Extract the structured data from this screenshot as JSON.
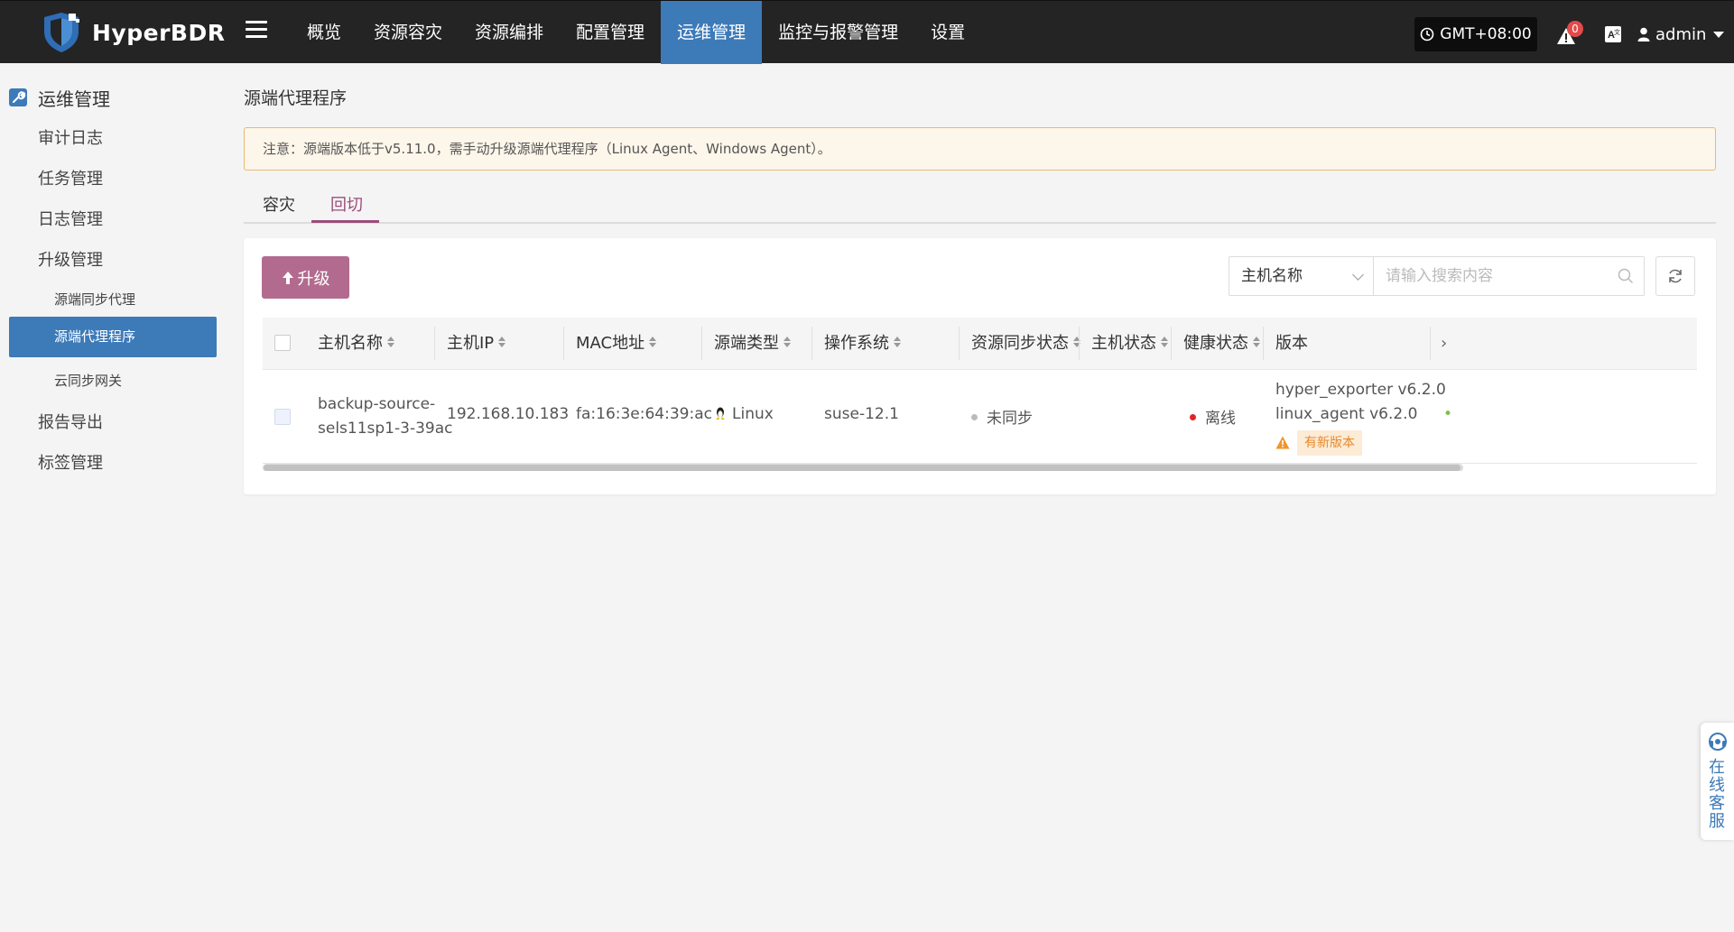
{
  "header": {
    "brand": "HyperBDR",
    "nav": [
      {
        "label": "概览"
      },
      {
        "label": "资源容灾"
      },
      {
        "label": "资源编排"
      },
      {
        "label": "配置管理"
      },
      {
        "label": "运维管理",
        "active": true
      },
      {
        "label": "监控与报警管理"
      },
      {
        "label": "设置"
      }
    ],
    "timezone": "GMT+08:00",
    "alert_count": "0",
    "user": "admin"
  },
  "sidebar": {
    "section_title": "运维管理",
    "items": [
      {
        "label": "审计日志"
      },
      {
        "label": "任务管理"
      },
      {
        "label": "日志管理"
      },
      {
        "label": "升级管理"
      },
      {
        "label": "源端同步代理",
        "sub": true
      },
      {
        "label": "源端代理程序",
        "sub": true,
        "active": true
      },
      {
        "label": "云同步网关",
        "sub": true
      },
      {
        "label": "报告导出"
      },
      {
        "label": "标签管理"
      }
    ]
  },
  "main": {
    "title": "源端代理程序",
    "notice": "注意：源端版本低于v5.11.0，需手动升级源端代理程序（Linux Agent、Windows Agent）。",
    "tabs": [
      {
        "label": "容灾"
      },
      {
        "label": "回切",
        "active": true
      }
    ],
    "upgrade_label": "升级",
    "filter_field": "主机名称",
    "search_placeholder": "请输入搜索内容",
    "table": {
      "columns": [
        "主机名称",
        "主机IP",
        "MAC地址",
        "源端类型",
        "操作系统",
        "资源同步状态",
        "主机状态",
        "健康状态",
        "版本"
      ],
      "rows": [
        {
          "hostname_line1": "backup-source-",
          "hostname_line2": "sels11sp1-3-39ac",
          "ip": "192.168.10.183",
          "mac": "fa:16:3e:64:39:ac",
          "source_type": "Linux",
          "os": "suse-12.1",
          "sync_status": "未同步",
          "host_status": "",
          "health_status": "离线",
          "version_line1": "hyper_exporter v6.2.0",
          "version_line2": "linux_agent v6.2.0",
          "version_tag": "有新版本"
        }
      ]
    }
  },
  "chat_widget": {
    "label": "在线客服"
  },
  "colors": {
    "topbar": "#242424",
    "accent_blue": "#3d7ab8",
    "accent_pink": "#b26b8e",
    "tab_active": "#9b4d7a",
    "notice_bg": "#fdf6ea",
    "offline_dot": "#e02424",
    "unsynced_dot": "#bbbbbb",
    "warning": "#f0962a"
  }
}
